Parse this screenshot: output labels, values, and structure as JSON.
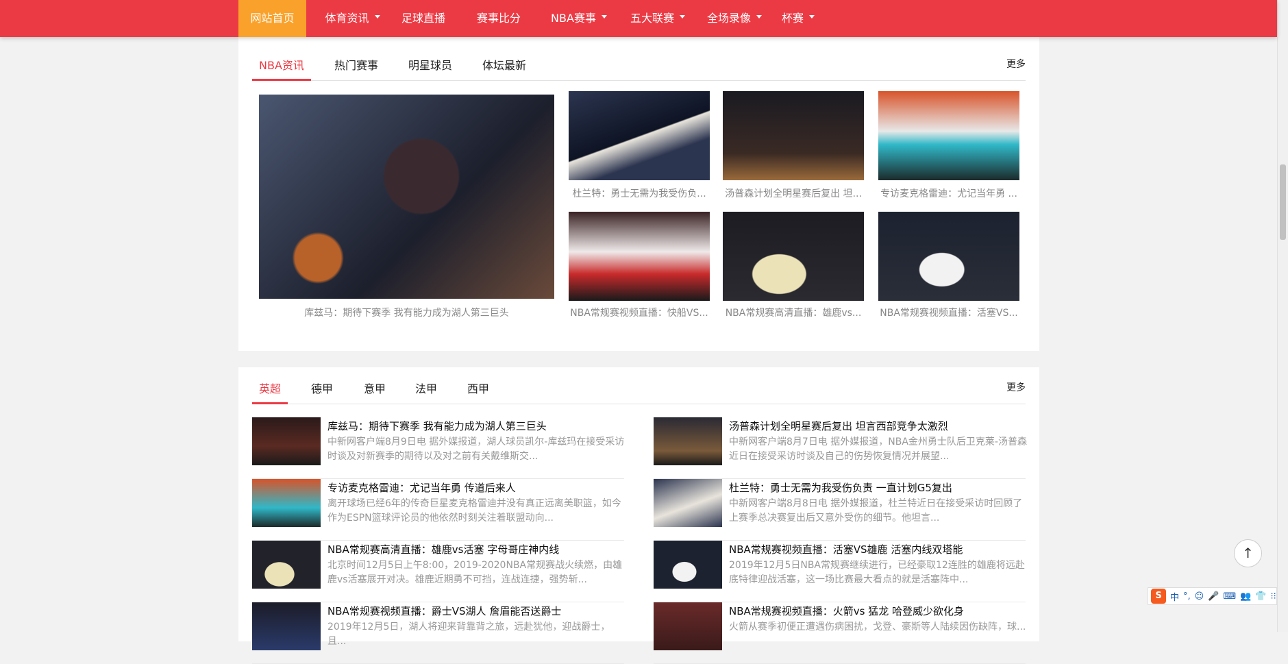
{
  "nav": {
    "items": [
      {
        "label": "网站首页",
        "dropdown": false
      },
      {
        "label": "体育资讯",
        "dropdown": true
      },
      {
        "label": "足球直播",
        "dropdown": false
      },
      {
        "label": "赛事比分",
        "dropdown": false
      },
      {
        "label": "NBA赛事",
        "dropdown": true
      },
      {
        "label": "五大联赛",
        "dropdown": true
      },
      {
        "label": "全场录像",
        "dropdown": true
      },
      {
        "label": "杯赛",
        "dropdown": true
      }
    ]
  },
  "nba_panel": {
    "tabs": [
      "NBA资讯",
      "热门赛事",
      "明星球员",
      "体坛最新"
    ],
    "more": "更多",
    "featured": {
      "caption": "库兹马：期待下赛季 我有能力成为湖人第三巨头"
    },
    "grid": [
      {
        "caption": "杜兰特：勇士无需为我受伤负..."
      },
      {
        "caption": "汤普森计划全明星赛后复出 坦..."
      },
      {
        "caption": "专访麦克格雷迪：尤记当年勇 ..."
      },
      {
        "caption": "NBA常规赛视频直播：快船VS..."
      },
      {
        "caption": "NBA常规赛高清直播：雄鹿vs..."
      },
      {
        "caption": "NBA常规赛视频直播：活塞VS..."
      }
    ]
  },
  "football_panel": {
    "tabs": [
      "英超",
      "德甲",
      "意甲",
      "法甲",
      "西甲"
    ],
    "more": "更多",
    "articles": [
      {
        "title": "库兹马：期待下赛季 我有能力成为湖人第三巨头",
        "desc": "中新网客户端8月9日电 据外媒报道，湖人球员凯尔-库兹玛在接受采访时谈及对新赛季的期待以及对之前有关戴维斯交..."
      },
      {
        "title": "汤普森计划全明星赛后复出 坦言西部竞争太激烈",
        "desc": "中新网客户端8月7日电 据外媒报道，NBA金州勇士队后卫克莱-汤普森近日在接受采访时谈及自己的伤势恢复情况并展望..."
      },
      {
        "title": "专访麦克格雷迪：尤记当年勇 传道后来人",
        "desc": "离开球场已经6年的传奇巨星麦克格雷迪并没有真正远离美职篮，如今作为ESPN篮球评论员的他依然时刻关注着联盟动向..."
      },
      {
        "title": "杜兰特：勇士无需为我受伤负责 一直计划G5复出",
        "desc": "中新网客户端8月8日电 据外媒报道，杜兰特近日在接受采访时回顾了上赛季总决赛复出后又意外受伤的细节。他坦言..."
      },
      {
        "title": "NBA常规赛高清直播：雄鹿vs活塞 字母哥庄神内线",
        "desc": "北京时间12月5日上午8:00，2019-2020NBA常规赛战火续燃，由雄鹿vs活塞展开对决。雄鹿近期勇不可挡，连战连捷，强势斩..."
      },
      {
        "title": "NBA常规赛视频直播：活塞VS雄鹿 活塞内线双塔能",
        "desc": "2019年12月5日NBA常规赛继续进行，已经豪取12连胜的雄鹿将远赴底特律迎战活塞，这一场比赛最大看点的就是活塞阵中..."
      },
      {
        "title": "NBA常规赛视频直播：爵士VS湖人 詹眉能否送爵士",
        "desc": "2019年12月5日，湖人将迎来背靠背之旅，远赴犹他，迎战爵士，且..."
      },
      {
        "title": "NBA常规赛视频直播：火箭vs 猛龙 哈登威少欲化身",
        "desc": "火箭从赛季初便正遭遇伤病困扰，戈登、豪斯等人陆续因伤缺阵，球..."
      }
    ]
  },
  "back_to_top": "↑",
  "ime": {
    "logo": "S",
    "items": [
      "中",
      "°,",
      "☺",
      "🎤",
      "⌨",
      "👥",
      "👕",
      "⁝⁝"
    ]
  }
}
